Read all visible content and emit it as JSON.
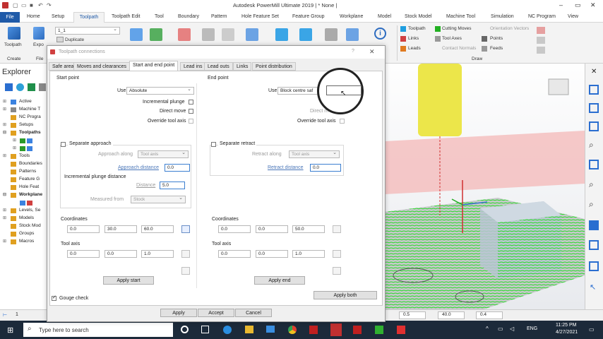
{
  "window": {
    "title": "Autodesk PowerMill Ultimate 2019 | * None |"
  },
  "ribbon_tabs": [
    "File",
    "Home",
    "Setup",
    "Toolpath",
    "Toolpath Edit",
    "Tool",
    "Boundary",
    "Pattern",
    "Hole Feature Set",
    "Feature Group",
    "Workplane",
    "Model",
    "Stock Model",
    "Machine Tool",
    "Simulation",
    "NC Program",
    "View"
  ],
  "ribbon": {
    "toolpath_btn": "Toolpath",
    "export_btn": "Expo",
    "create_group": "Create",
    "file_group": "File",
    "toolpath_select": "1_1",
    "duplicate_btn": "Duplicate",
    "display_group": "Draw",
    "draw_items": [
      "Toolpath",
      "Cutting Moves",
      "Orientation Vectors",
      "Links",
      "Tool Axes",
      "Points",
      "Leads",
      "Contact Normals",
      "Feeds"
    ]
  },
  "explorer": {
    "title": "Explorer",
    "items": [
      "Active",
      "Machine T",
      "NC Progra",
      "Setups",
      "Toolpaths",
      "Tools",
      "Boundaries",
      "Patterns",
      "Feature G",
      "Hole Feat",
      "Workplane",
      "Levels, Se",
      "Models",
      "Stock Mod",
      "Groups",
      "Macros"
    ]
  },
  "dialog": {
    "title": "Toolpath connections",
    "tabs": [
      "Safe area",
      "Moves and clearances",
      "Start and end point",
      "Lead ins",
      "Lead outs",
      "Links",
      "Point distribution"
    ],
    "start": {
      "section": "Start point",
      "use_label": "Use",
      "use_value": "Absolute",
      "incremental_plunge": "Incremental plunge",
      "direct_move": "Direct move",
      "override_tool_axis": "Override tool axis",
      "separate_approach": "Separate approach",
      "approach_along": "Approach along",
      "approach_along_value": "Tool axis",
      "approach_distance": "Approach distance",
      "approach_distance_value": "0.0",
      "incr_plunge_distance": "Incremental plunge distance",
      "distance": "Distance",
      "distance_value": "5.0",
      "measured_from": "Measured from",
      "measured_from_value": "Stock",
      "coordinates": "Coordinates",
      "coords": [
        "0.0",
        "30.0",
        "60.0"
      ],
      "tool_axis": "Tool axis",
      "axis": [
        "0.0",
        "0.0",
        "1.0"
      ],
      "apply_btn": "Apply start"
    },
    "end": {
      "section": "End point",
      "use_label": "Use",
      "use_value": "Block centre saf",
      "direct_move": "Direct m",
      "override_tool_axis": "Override tool axis",
      "separate_retract": "Separate retract",
      "retract_along": "Retract along",
      "retract_along_value": "Tool axis",
      "retract_distance": "Retract distance",
      "retract_distance_value": "0.0",
      "coordinates": "Coordinates",
      "coords": [
        "0.0",
        "0.0",
        "50.0"
      ],
      "tool_axis": "Tool axis",
      "axis": [
        "0.0",
        "0.0",
        "1.0"
      ],
      "apply_btn": "Apply end"
    },
    "gouge_check": "Gouge check",
    "apply_both": "Apply both",
    "apply": "Apply",
    "accept": "Accept",
    "cancel": "Cancel"
  },
  "statusbar": {
    "left_value": "1",
    "v1": "0.5",
    "v2": "40.0",
    "v3": "0.4"
  },
  "taskbar": {
    "search_placeholder": "Type here to search",
    "lang": "ENG",
    "time": "11:25 PM",
    "date": "4/27/2021"
  },
  "colors": {
    "accent": "#1f5aa8",
    "toolpath_green": "#22dd22",
    "tool_yellow": "#ece64a"
  }
}
